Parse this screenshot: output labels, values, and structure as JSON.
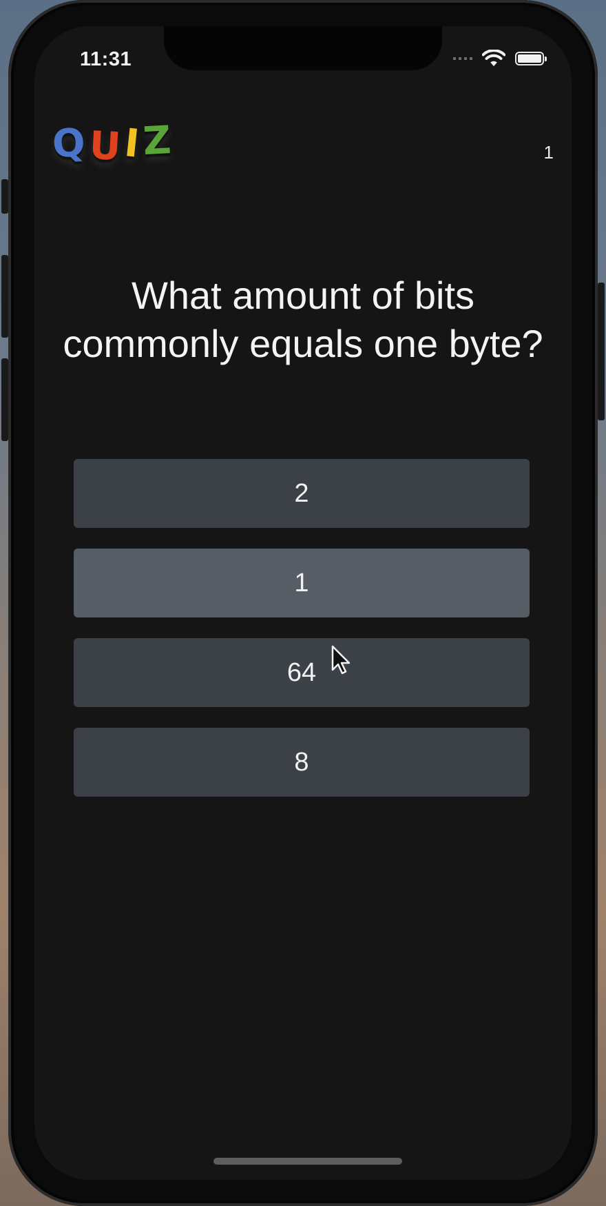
{
  "status_bar": {
    "time": "11:31"
  },
  "header": {
    "logo_letters": [
      "Q",
      "U",
      "I",
      "Z"
    ],
    "score": "1"
  },
  "question": {
    "text": "What amount of bits commonly equals one byte?"
  },
  "answers": [
    {
      "label": "2"
    },
    {
      "label": "1"
    },
    {
      "label": "64"
    },
    {
      "label": "8"
    }
  ],
  "colors": {
    "screen_bg": "#151515",
    "answer_bg": "#3c4147",
    "answer_highlight_bg": "#575d64",
    "logo_q": "#4a74c9",
    "logo_u": "#e0421e",
    "logo_i": "#f1c222",
    "logo_z": "#57a637"
  },
  "icons": [
    "wifi-icon",
    "battery-icon",
    "cellular-signal-icon",
    "mouse-cursor-icon"
  ]
}
